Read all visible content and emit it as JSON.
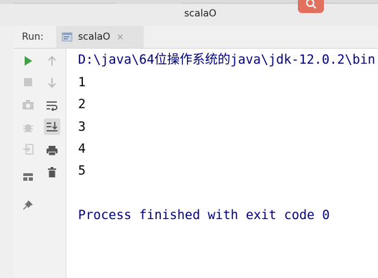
{
  "window": {
    "title": "scalaO"
  },
  "run_panel": {
    "label": "Run:",
    "tab": {
      "label": "scalaO",
      "close_glyph": "×"
    }
  },
  "toolbar": {
    "left": [
      {
        "name": "run-icon",
        "color": "#43a047"
      },
      {
        "name": "stop-icon"
      },
      {
        "name": "camera-icon"
      },
      {
        "name": "debug-icon"
      },
      {
        "name": "exit-icon"
      },
      {
        "name": "layout-icon"
      },
      {
        "name": "pin-icon"
      }
    ],
    "right": [
      {
        "name": "arrow-up-icon"
      },
      {
        "name": "arrow-down-icon"
      },
      {
        "name": "soft-wrap-icon"
      },
      {
        "name": "scroll-to-end-icon",
        "active": true
      },
      {
        "name": "print-icon"
      },
      {
        "name": "trash-icon"
      }
    ]
  },
  "console": {
    "command": "D:\\java\\64位操作系统的java\\jdk-12.0.2\\bin",
    "outputs": [
      "1",
      "2",
      "3",
      "4",
      "5"
    ],
    "exit_message": "Process finished with exit code 0"
  },
  "colors": {
    "accent": "#e2705f",
    "console_text": "#000080"
  }
}
